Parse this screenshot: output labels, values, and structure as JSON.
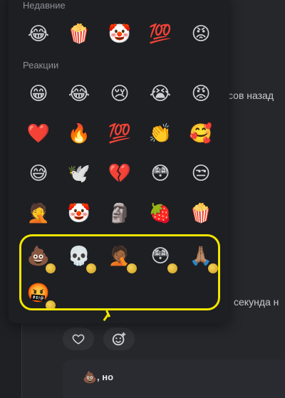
{
  "sections": {
    "recent_title": "Недавние",
    "reactions_title": "Реакции"
  },
  "recent": [
    {
      "char": "😂",
      "name": "tears-of-joy-emoji"
    },
    {
      "char": "🍿",
      "name": "popcorn-emoji"
    },
    {
      "char": "🤡",
      "name": "clown-emoji"
    },
    {
      "char": "💯",
      "name": "hundred-points-emoji"
    },
    {
      "char": "😡",
      "name": "angry-face-emoji"
    }
  ],
  "reactions": [
    {
      "char": "😁",
      "name": "grinning-emoji"
    },
    {
      "char": "😂",
      "name": "tears-of-joy-emoji"
    },
    {
      "char": "😢",
      "name": "crying-emoji"
    },
    {
      "char": "😭",
      "name": "sobbing-emoji"
    },
    {
      "char": "😡",
      "name": "angry-emoji"
    },
    {
      "char": "❤️",
      "name": "heart-emoji"
    },
    {
      "char": "🔥",
      "name": "fire-emoji"
    },
    {
      "char": "💯",
      "name": "hundred-emoji"
    },
    {
      "char": "👏",
      "name": "clap-emoji"
    },
    {
      "char": "🥰",
      "name": "smiling-hearts-emoji"
    },
    {
      "char": "😅",
      "name": "sweat-smile-emoji"
    },
    {
      "char": "🕊️",
      "name": "dove-emoji"
    },
    {
      "char": "💔",
      "name": "broken-heart-emoji"
    },
    {
      "char": "😳",
      "name": "flushed-emoji"
    },
    {
      "char": "😒",
      "name": "unamused-emoji"
    },
    {
      "char": "🤦",
      "name": "facepalm-emoji"
    },
    {
      "char": "🤡",
      "name": "clown-emoji"
    },
    {
      "char": "🗿",
      "name": "moai-emoji"
    },
    {
      "char": "🍓",
      "name": "strawberry-emoji"
    },
    {
      "char": "🍿",
      "name": "popcorn-emoji"
    }
  ],
  "premium": [
    {
      "char": "💩",
      "name": "poop-emoji"
    },
    {
      "char": "💀",
      "name": "skull-emoji"
    },
    {
      "char": "🤦🏾",
      "name": "facepalm-dark-emoji"
    },
    {
      "char": "😳",
      "name": "shocked-dark-emoji"
    },
    {
      "char": "🙏🏽",
      "name": "pray-emoji"
    },
    {
      "char": "🤬",
      "name": "cursing-emoji"
    }
  ],
  "background": {
    "line1": "сов назад",
    "line2": "секунда н"
  },
  "message": {
    "emoji": "💩",
    "text": ", но"
  },
  "buttons": {
    "heart_icon": "♡",
    "add_reaction_icon": "☺"
  },
  "colors": {
    "highlight": "#f2e500",
    "popup_bg": "#1e1f23"
  }
}
